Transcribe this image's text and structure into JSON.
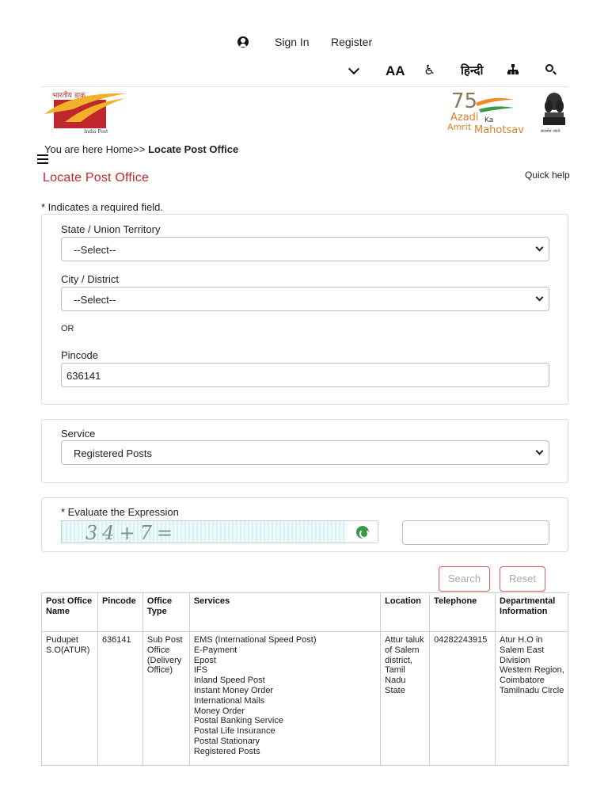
{
  "header": {
    "sign_in": "Sign In",
    "register": "Register",
    "icons": [
      "user-icon",
      "chevron-down-icon",
      "font-size-icon",
      "accessibility-icon",
      "hindi-language-toggle",
      "sitemap-icon",
      "search-icon"
    ],
    "hindi_label": "हिन्दी",
    "font_size_glyph": "AA",
    "access_glyph": "♿"
  },
  "logos": {
    "india_post_top": "भारतीय डाक",
    "india_post_bottom": "India Post",
    "azadi_75": "75",
    "azadi_line1": "Azadi",
    "azadi_ka": "Ka",
    "azadi_line2": "Amrit",
    "azadi_line3": "Mahotsav",
    "emblem_caption": "सत्यमेव जयते"
  },
  "breadcrumb": {
    "prefix": "You are here ",
    "home": "Home>>",
    "current": " Locate Post Office"
  },
  "page": {
    "title": "Locate Post Office",
    "quick_help": "Quick help",
    "required_note": "* Indicates a required field."
  },
  "form": {
    "state_label": "State / Union Territory",
    "state_value": "--Select--",
    "city_label": "City / District",
    "city_value": "--Select--",
    "or_text": "OR",
    "pincode_label": "Pincode",
    "pincode_value": "636141",
    "service_label": "Service",
    "service_value": "Registered Posts",
    "captcha_label": "* Evaluate the Expression",
    "captcha_text": "34+7=",
    "captcha_answer": ""
  },
  "buttons": {
    "search": "Search",
    "reset": "Reset"
  },
  "table": {
    "headers": [
      "Post Office Name",
      "Pincode",
      "Office Type",
      "Services",
      "Location",
      "Telephone",
      "Departmental Information"
    ],
    "rows": [
      {
        "name": "Pudupet S.O(ATUR)",
        "pincode": "636141",
        "office_type": "Sub Post Office (Delivery Office)",
        "services": [
          "EMS (International Speed Post)",
          "E-Payment",
          "Epost",
          "IFS",
          "Inland Speed Post",
          "Instant Money Order",
          "International Mails",
          "Money Order",
          "Postal Banking Service",
          "Postal Life Insurance",
          "Postal Stationary",
          "Registered Posts"
        ],
        "location": "Attur taluk of Salem district, Tamil Nadu State",
        "telephone": "04282243915",
        "departmental": "Atur H.O in Salem East Division Western Region, Coimbatore Tamilnadu Circle"
      }
    ]
  }
}
